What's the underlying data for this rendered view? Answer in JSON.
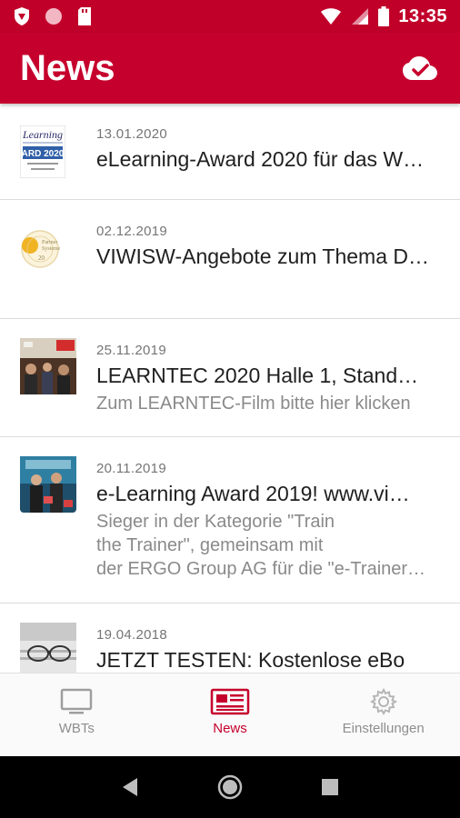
{
  "status_bar": {
    "time": "13:35",
    "icons": [
      "shield-icon",
      "circle-icon",
      "sd-card-icon",
      "wifi-icon",
      "signal-icon",
      "battery-icon"
    ]
  },
  "app_bar": {
    "title": "News",
    "action_icon": "cloud-done-icon",
    "background_color": "#c6002d"
  },
  "news": [
    {
      "date": "13.01.2020",
      "title": "eLearning-Award 2020 für das W…",
      "subtitle": "",
      "thumb": "award-2020-badge"
    },
    {
      "date": "02.12.2019",
      "title": "VIWISW-Angebote zum Thema D…",
      "subtitle": "",
      "thumb": "gold-seal"
    },
    {
      "date": "25.11.2019",
      "title": "LEARNTEC 2020 Halle 1, Stand…",
      "subtitle": "Zum LEARNTEC-Film bitte hier klicken",
      "thumb": "learntec-photo"
    },
    {
      "date": "20.11.2019",
      "title": "e-Learning Award 2019!   www.vi…",
      "subtitle_lines": [
        "Sieger in der Kategorie \"Train",
        "the Trainer\", gemeinsam mit",
        "der ERGO Group AG für die \"e-Trainer…"
      ],
      "thumb": "award-photo"
    },
    {
      "date": "19.04.2018",
      "title": "JETZT TESTEN: Kostenlose eBo",
      "subtitle": "",
      "thumb": "glasses-photo"
    }
  ],
  "bottom_nav": {
    "items": [
      {
        "label": "WBTs",
        "icon": "monitor-icon",
        "active": false
      },
      {
        "label": "News",
        "icon": "newspaper-icon",
        "active": true
      },
      {
        "label": "Einstellungen",
        "icon": "gear-icon",
        "active": false
      }
    ],
    "active_color": "#c6002d"
  },
  "system_nav": {
    "icons": [
      "back-icon",
      "home-icon",
      "recents-icon"
    ]
  }
}
